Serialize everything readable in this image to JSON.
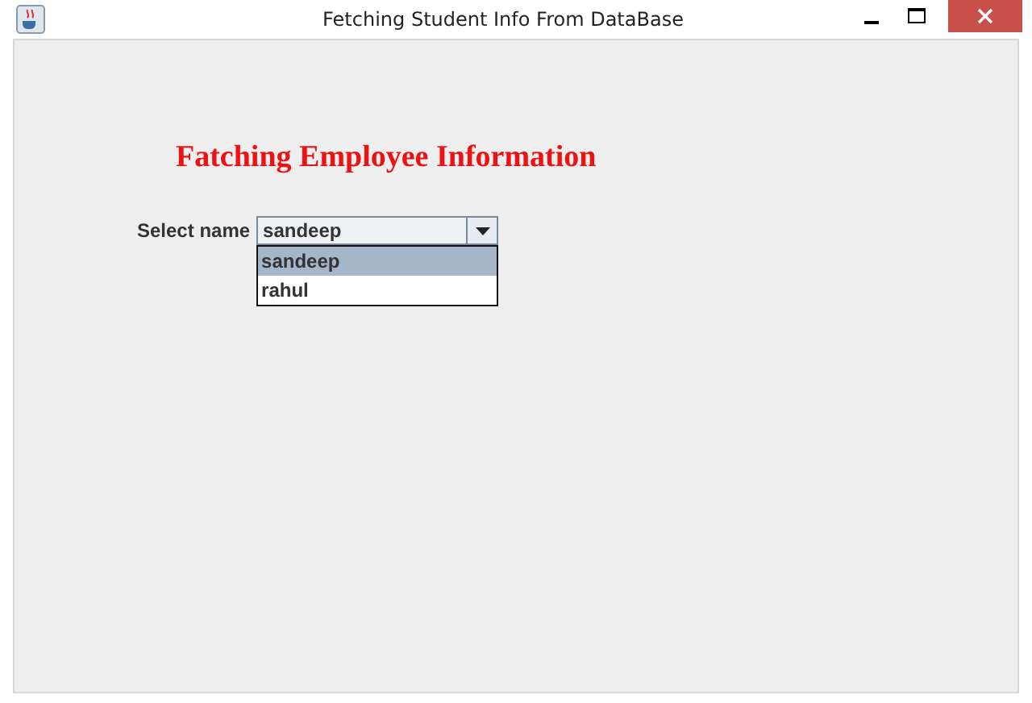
{
  "window": {
    "title": "Fetching Student Info From DataBase"
  },
  "heading": "Fatching Employee Information",
  "select": {
    "label": "Select name",
    "value": "sandeep",
    "expanded": true,
    "options": [
      {
        "label": "sandeep",
        "selected": true
      },
      {
        "label": "rahul",
        "selected": false
      }
    ]
  }
}
